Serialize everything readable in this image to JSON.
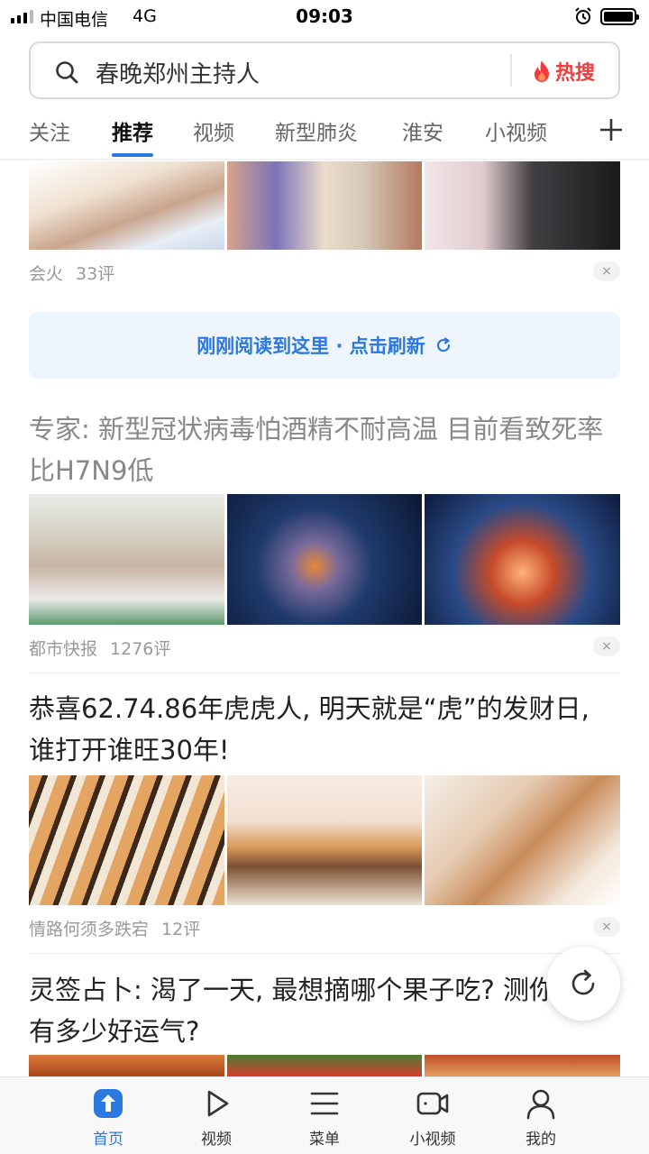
{
  "status_bar": {
    "carrier": "中国电信",
    "network": "4G",
    "time": "09:03"
  },
  "search": {
    "query": "春晚郑州主持人",
    "hot_label": "热搜"
  },
  "tabs": [
    {
      "label": "关注"
    },
    {
      "label": "推荐"
    },
    {
      "label": "视频"
    },
    {
      "label": "新型肺炎"
    },
    {
      "label": "淮安"
    },
    {
      "label": "小视频"
    }
  ],
  "feed": {
    "item0": {
      "source": "会火",
      "comments": "33评"
    },
    "refresh_banner": "刚刚阅读到这里 · 点击刷新",
    "item1": {
      "title": "专家: 新型冠状病毒怕酒精不耐高温 目前看致死率比H7N9低",
      "source": "都市快报",
      "comments": "1276评"
    },
    "item2": {
      "title": "恭喜62.74.86年虎虎人, 明天就是“虎”的发财日, 谁打开谁旺30年!",
      "source": "情路何须多跌宕",
      "comments": "12评"
    },
    "item3": {
      "title": "灵签占卜: 渴了一天, 最想摘哪个果子吃? 测你1月有多少好运气?"
    }
  },
  "close_symbol": "×",
  "bottom_nav": [
    {
      "label": "首页",
      "icon": "home-icon"
    },
    {
      "label": "视频",
      "icon": "play-icon"
    },
    {
      "label": "菜单",
      "icon": "menu-icon"
    },
    {
      "label": "小视频",
      "icon": "camera-icon"
    },
    {
      "label": "我的",
      "icon": "user-icon"
    }
  ],
  "colors": {
    "accent": "#2b79e0",
    "hot": "#f03c3c"
  }
}
